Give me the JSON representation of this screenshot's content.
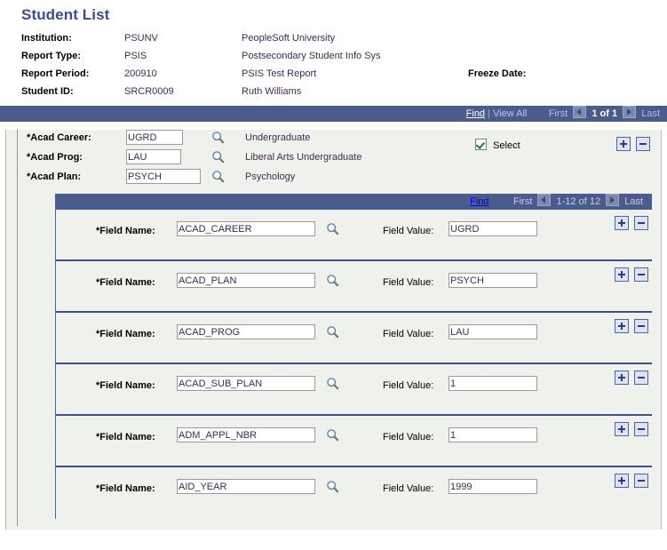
{
  "page": {
    "title": "Student List"
  },
  "header": {
    "rows": [
      {
        "label": "Institution:",
        "value": "PSUNV",
        "description": "PeopleSoft University"
      },
      {
        "label": "Report Type:",
        "value": "PSIS",
        "description": "Postsecondary Student Info Sys"
      },
      {
        "label": "Report Period:",
        "value": "200910",
        "description": "PSIS Test Report",
        "extra_label": "Freeze Date:",
        "extra_value": ""
      },
      {
        "label": "Student ID:",
        "value": "SRCR0009",
        "description": "Ruth Williams"
      }
    ]
  },
  "outer_nav": {
    "find": "Find",
    "separator": "|",
    "view_all": "View All",
    "first": "First",
    "counter": "1 of 1",
    "last": "Last",
    "prev_icon": "left-arrow-icon",
    "next_icon": "right-arrow-icon"
  },
  "acad": {
    "career": {
      "label": "*Acad Career:",
      "value": "UGRD",
      "description": "Undergraduate"
    },
    "prog": {
      "label": "*Acad Prog:",
      "value": "LAU",
      "description": "Liberal Arts Undergraduate"
    },
    "plan": {
      "label": "*Acad Plan:",
      "value": "PSYCH",
      "description": "Psychology"
    },
    "lookup_icon": "magnifier-icon"
  },
  "select": {
    "label": "Select",
    "checked": true
  },
  "outer_row_buttons": {
    "add": "+",
    "remove": "-"
  },
  "grid_nav": {
    "find": "Find",
    "first": "First",
    "counter": "1-12 of 12",
    "last": "Last",
    "prev_icon": "left-arrow-icon",
    "next_icon": "right-arrow-icon"
  },
  "grid": {
    "field_name_label": "*Field Name:",
    "field_value_label": "Field Value:",
    "lookup_icon": "magnifier-icon",
    "rows": [
      {
        "field_name": "ACAD_CAREER",
        "field_value": "UGRD"
      },
      {
        "field_name": "ACAD_PLAN",
        "field_value": "PSYCH"
      },
      {
        "field_name": "ACAD_PROG",
        "field_value": "LAU"
      },
      {
        "field_name": "ACAD_SUB_PLAN",
        "field_value": "1"
      },
      {
        "field_name": "ADM_APPL_NBR",
        "field_value": "1"
      },
      {
        "field_name": "AID_YEAR",
        "field_value": "1999"
      }
    ]
  },
  "colors": {
    "title": "#3b4d8f",
    "navbar": "#4c5b8e",
    "panel": "#eff1ec",
    "value_text": "#3f2a56",
    "row_divider": "#3f5183",
    "check": "#1f7a2e"
  }
}
